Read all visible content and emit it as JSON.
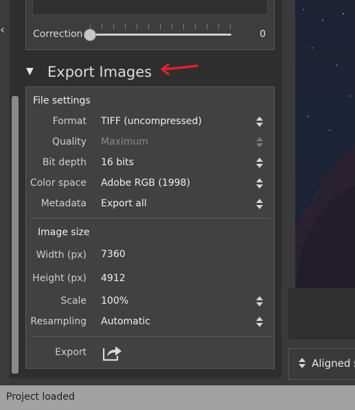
{
  "side": {
    "collapse_glyph": "‹"
  },
  "correction": {
    "label": "Correction",
    "value": "0",
    "slider_fraction": 0.0
  },
  "section": {
    "triangle": "▼",
    "title": "Export Images"
  },
  "file_settings": {
    "title": "File settings",
    "rows": [
      {
        "label": "Format",
        "value": "TIFF (uncompressed)",
        "enabled": true
      },
      {
        "label": "Quality",
        "value": "Maximum",
        "enabled": false
      },
      {
        "label": "Bit depth",
        "value": "16 bits",
        "enabled": true
      },
      {
        "label": "Color space",
        "value": "Adobe RGB (1998)",
        "enabled": true
      },
      {
        "label": "Metadata",
        "value": "Export all",
        "enabled": true
      }
    ]
  },
  "image_size": {
    "title": "Image size",
    "width_label": "Width (px)",
    "width_value": "7360",
    "height_label": "Height (px)",
    "height_value": "4912",
    "scale_label": "Scale",
    "scale_value": "100%",
    "resampling_label": "Resampling",
    "resampling_value": "Automatic"
  },
  "export": {
    "label": "Export",
    "icon": "export-share-icon"
  },
  "right_panel": {
    "aligned_label": "Aligned s"
  },
  "status": {
    "text": "Project loaded"
  },
  "colors": {
    "annotation_arrow": "#e0212b",
    "status_bar": "#a2a2a2",
    "panel_bg": "#414141"
  }
}
